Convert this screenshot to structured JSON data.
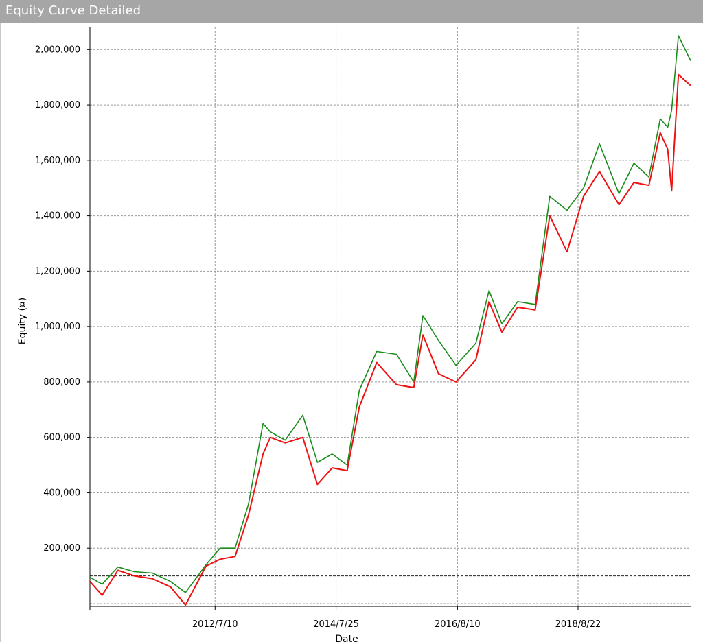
{
  "window": {
    "title": "Equity Curve Detailed"
  },
  "chart_data": {
    "type": "line",
    "title": "",
    "xlabel": "Date",
    "ylabel": "Equity (¤)",
    "y_ticks": [
      "200,000",
      "400,000",
      "600,000",
      "800,000",
      "1,000,000",
      "1,200,000",
      "1,400,000",
      "1,600,000",
      "1,800,000",
      "2,000,000"
    ],
    "x_ticks": [
      "2012/7/10",
      "2014/7/25",
      "2016/8/10",
      "2018/8/22"
    ],
    "ylim": [
      -10000,
      2080000
    ],
    "xlim": [
      "2010-06-01",
      "2020-07-15"
    ],
    "reference_line_y": 100000,
    "grid": true,
    "colors": {
      "high": "#1a8c1a",
      "close": "#ee1111"
    },
    "series": [
      {
        "name": "",
        "color": "#1a8c1a",
        "x": [
          "2010-06-01",
          "2010-08-15",
          "2010-11-20",
          "2011-03-01",
          "2011-06-20",
          "2011-10-10",
          "2012-01-10",
          "2012-05-15",
          "2012-08-10",
          "2012-11-10",
          "2013-02-01",
          "2013-05-01",
          "2013-06-15",
          "2013-09-15",
          "2014-01-01",
          "2014-04-01",
          "2014-07-01",
          "2014-10-01",
          "2014-12-15",
          "2015-04-01",
          "2015-08-01",
          "2015-11-15",
          "2016-01-10",
          "2016-04-15",
          "2016-08-01",
          "2016-12-01",
          "2017-02-20",
          "2017-05-10",
          "2017-08-15",
          "2017-12-01",
          "2018-03-01",
          "2018-06-15",
          "2018-09-25",
          "2019-01-01",
          "2019-05-01",
          "2019-08-01",
          "2019-11-01",
          "2020-01-10",
          "2020-02-25",
          "2020-03-20",
          "2020-05-01",
          "2020-07-15"
        ],
        "values": [
          95000,
          70000,
          132000,
          115000,
          110000,
          80000,
          40000,
          140000,
          200000,
          200000,
          360000,
          650000,
          620000,
          590000,
          680000,
          510000,
          540000,
          500000,
          770000,
          910000,
          900000,
          800000,
          1040000,
          950000,
          860000,
          940000,
          1130000,
          1010000,
          1090000,
          1080000,
          1470000,
          1420000,
          1500000,
          1660000,
          1480000,
          1590000,
          1540000,
          1750000,
          1720000,
          1780000,
          2050000,
          1960000
        ]
      },
      {
        "name": "",
        "color": "#ee1111",
        "x": [
          "2010-06-01",
          "2010-08-15",
          "2010-11-20",
          "2011-03-01",
          "2011-06-20",
          "2011-10-10",
          "2012-01-10",
          "2012-05-15",
          "2012-08-10",
          "2012-11-10",
          "2013-02-01",
          "2013-05-01",
          "2013-06-15",
          "2013-09-15",
          "2014-01-01",
          "2014-04-01",
          "2014-07-01",
          "2014-10-01",
          "2014-12-15",
          "2015-04-01",
          "2015-08-01",
          "2015-11-15",
          "2016-01-10",
          "2016-04-15",
          "2016-08-01",
          "2016-12-01",
          "2017-02-20",
          "2017-05-10",
          "2017-08-15",
          "2017-12-01",
          "2018-03-01",
          "2018-06-15",
          "2018-09-25",
          "2019-01-01",
          "2019-05-01",
          "2019-08-01",
          "2019-11-01",
          "2020-01-10",
          "2020-02-25",
          "2020-03-20",
          "2020-05-01",
          "2020-07-15"
        ],
        "values": [
          80000,
          30000,
          120000,
          100000,
          90000,
          60000,
          -5000,
          135000,
          160000,
          170000,
          320000,
          540000,
          600000,
          580000,
          600000,
          430000,
          490000,
          480000,
          710000,
          870000,
          790000,
          780000,
          970000,
          830000,
          800000,
          880000,
          1090000,
          980000,
          1070000,
          1060000,
          1400000,
          1270000,
          1470000,
          1560000,
          1440000,
          1520000,
          1510000,
          1700000,
          1640000,
          1490000,
          1910000,
          1870000
        ]
      }
    ]
  }
}
